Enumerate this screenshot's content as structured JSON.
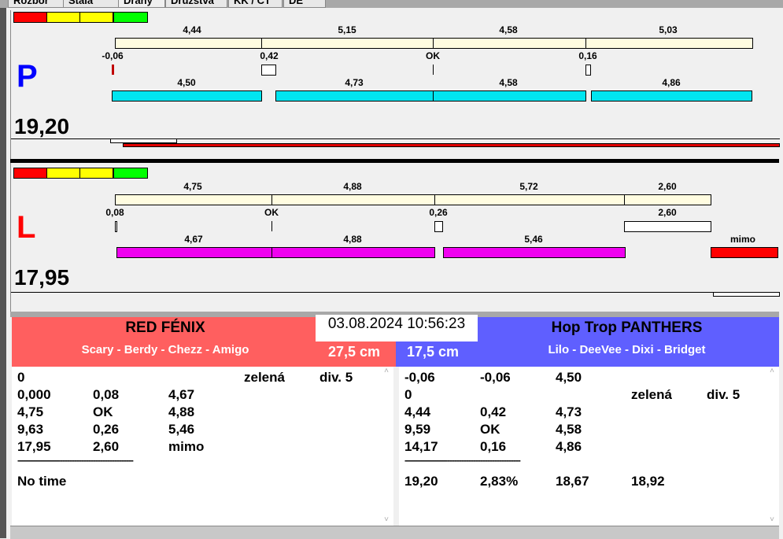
{
  "tabs": [
    "Rozbor",
    "Stala",
    "Dráhy",
    "Družstva",
    "KK / CT",
    "DE"
  ],
  "colors": {
    "red": "#ff0000",
    "yellow": "#ffff00",
    "green": "#00ff00",
    "cream": "#fffce0",
    "cyan": "#00e5f0",
    "magenta": "#f000f0",
    "team1": "#ff5f5f",
    "team2": "#5f5fff"
  },
  "lane_p": {
    "letter": "P",
    "total": "19,20",
    "top_values": [
      "4,44",
      "5,15",
      "4,58",
      "5,03"
    ],
    "deviations": [
      "-0,06",
      "0,42",
      "OK",
      "0,16"
    ],
    "bottom_values": [
      "4,50",
      "4,73",
      "4,58",
      "4,86"
    ]
  },
  "lane_l": {
    "letter": "L",
    "total": "17,95",
    "top_values": [
      "4,75",
      "4,88",
      "5,72",
      "2,60"
    ],
    "deviations": [
      "0,08",
      "OK",
      "0,26",
      "2,60"
    ],
    "bottom_values": [
      "4,67",
      "4,88",
      "5,46",
      "mimo"
    ]
  },
  "datetime": "03.08.2024 10:56:23",
  "team1": {
    "name": "RED FÉNIX",
    "players": "Scary - Berdy - Chezz - Amigo",
    "distance": "27,5 cm",
    "rows": [
      [
        "0",
        "",
        "",
        "zelená",
        "div. 5"
      ],
      [
        "0,000",
        "0,08",
        "4,67",
        "",
        ""
      ],
      [
        "4,75",
        "OK",
        "4,88",
        "",
        ""
      ],
      [
        "9,63",
        "0,26",
        "5,46",
        "",
        ""
      ],
      [
        "17,95",
        "2,60",
        "mimo",
        "",
        ""
      ]
    ],
    "separator": "-------------------------------------------------",
    "summary": [
      "No time",
      "",
      "",
      ""
    ]
  },
  "team2": {
    "name": "Hop Trop PANTHERS",
    "players": "Lilo - DeeVee - Dixi - Bridget",
    "distance": "17,5 cm",
    "rows": [
      [
        "-0,06",
        "-0,06",
        "4,50",
        "",
        ""
      ],
      [
        "0",
        "",
        "",
        "zelená",
        "div. 5"
      ],
      [
        "4,44",
        "0,42",
        "4,73",
        "",
        ""
      ],
      [
        "9,59",
        "OK",
        "4,58",
        "",
        ""
      ],
      [
        "14,17",
        "0,16",
        "4,86",
        "",
        ""
      ]
    ],
    "separator": "-------------------------------------------------",
    "summary": [
      "19,20",
      "2,83%",
      "18,67",
      "18,92"
    ]
  }
}
